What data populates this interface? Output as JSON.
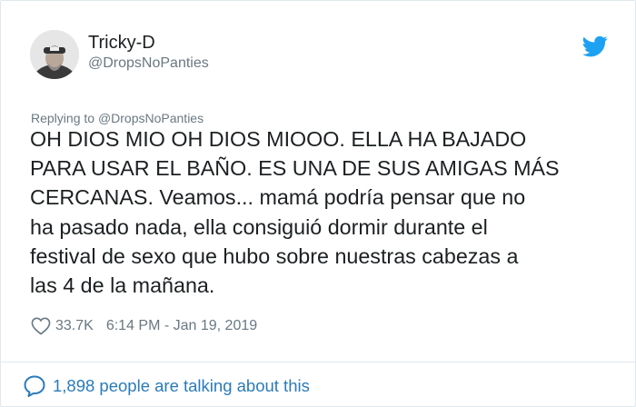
{
  "tweet": {
    "display_name": "Tricky-D",
    "handle": "@DropsNoPanties",
    "reply_prefix": "Replying to ",
    "reply_to": "@DropsNoPanties",
    "text": "OH DIOS MIO OH DIOS MIOOO. ELLA HA BAJADO\nPARA USAR EL BAÑO. ES UNA DE SUS AMIGAS MÁS\nCERCANAS. Veamos... mamá podría pensar que no\nha pasado nada, ella consiguió dormir durante el\nfestival de sexo que hubo sobre nuestras cabezas a\nlas 4 de la mañana.",
    "likes": "33.7K",
    "timestamp": "6:14 PM - Jan 19, 2019"
  },
  "footer": {
    "talking_label": "1,898 people are talking about this"
  },
  "icons": {
    "brand": "twitter-bird-icon",
    "like": "heart-icon",
    "conversation": "speech-bubble-icon"
  },
  "colors": {
    "brand_blue": "#1da1f2",
    "link_blue": "#2b7bb9",
    "text": "#1c2022",
    "muted": "#697882",
    "border": "#e1e8ed"
  }
}
